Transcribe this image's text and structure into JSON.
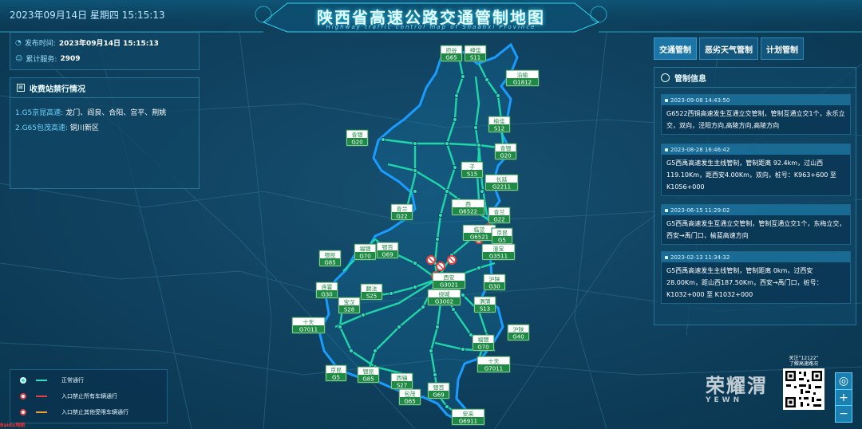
{
  "header": {
    "datetime": "2023年09月14日 星期四  15:15:13",
    "title": "陕西省高速公路交通管制地图",
    "subtitle": "Highway traffic control map of Shaanxi Province"
  },
  "info": {
    "publish_label": "发布时间:",
    "publish_value": "2023年09月14日  15:15:13",
    "service_label": "累计服务:",
    "service_value": "2909"
  },
  "toll": {
    "title": "收费站禁行情况",
    "items": [
      {
        "road": "1.G5京昆高速:",
        "text": "龙门、阎良、合阳、宫平、荆姚"
      },
      {
        "road": "2.G65包茂高速:",
        "text": "铜川新区"
      }
    ]
  },
  "tabs": [
    "交通管制",
    "恶劣天气管制",
    "计划管制"
  ],
  "control": {
    "title": "管制信息",
    "cards": [
      {
        "time": "2023-09-08 14:43:50",
        "text": "G6522西铜高速发生互通立交管制，管制互通立交1个，永乐立交，双向，泾阳方向,高陵方向,高陵方向"
      },
      {
        "time": "2023-08-28 16:46:42",
        "text": "G5西禹高速发生主线管制，管制距离 92.4km，过山西119.10Km，距西安4.00Km，双向，桩号：K963+600 至 K1056+000"
      },
      {
        "time": "2023-06-15 11:29:02",
        "text": "G5西禹高速发生互通立交管制，管制互通立交1个，东梅立交，西安→禹门口，榆蓝高速方向"
      },
      {
        "time": "2023-02-13 11:34:32",
        "text": "G5西禹高速发生主线管制，管制距离 0km，过西安28.00Km，距山西187.50Km，西安→禹门口，桩号：K1032+000 至 K1032+000"
      }
    ]
  },
  "legend": {
    "items": [
      {
        "label": "正常通行",
        "color": "#2fe0c0"
      },
      {
        "label": "入口禁止所有车辆通行",
        "color": "#e04040"
      },
      {
        "label": "入口禁止其他受限车辆通行",
        "color": "#f0a030"
      }
    ]
  },
  "qr": {
    "line1": "关注“12122”",
    "line2": "了解高速路况"
  },
  "zoom": {
    "locate": "◎",
    "plus": "+",
    "minus": "−"
  },
  "watermark": {
    "main": "荣耀渭",
    "sub": "YEWN"
  },
  "corner_logo": "Baidu地图",
  "colors": {
    "road": "#1fd6a8",
    "border": "#1a9cff",
    "accent": "#2ee3ff",
    "sign_green": "#1f8a44"
  },
  "map": {
    "signs": [
      {
        "name": "府谷",
        "code": "G65"
      },
      {
        "name": "神佳",
        "code": "S11"
      },
      {
        "name": "沿榆",
        "code": "G1812"
      },
      {
        "name": "榆佳",
        "code": "S12"
      },
      {
        "name": "青银",
        "code": "G20"
      },
      {
        "name": "青银",
        "code": "G20"
      },
      {
        "name": "子",
        "code": "S15"
      },
      {
        "name": "长延",
        "code": "G2211"
      },
      {
        "name": "西",
        "code": "G6522"
      },
      {
        "name": "青兰",
        "code": "G22"
      },
      {
        "name": "青兰",
        "code": "G22"
      },
      {
        "name": "临蓝",
        "code": "G6521"
      },
      {
        "name": "京昆",
        "code": "G5"
      },
      {
        "name": "潼宝",
        "code": "G3511"
      },
      {
        "name": "银昆",
        "code": "G85"
      },
      {
        "name": "福银",
        "code": "G70"
      },
      {
        "name": "银百",
        "code": "G69"
      },
      {
        "name": "西安",
        "code": "G3021"
      },
      {
        "name": "沪陕",
        "code": "G30"
      },
      {
        "name": "连霍",
        "code": "G30"
      },
      {
        "name": "麟法",
        "code": "S25"
      },
      {
        "name": "宝汉",
        "code": "S28"
      },
      {
        "name": "绕城",
        "code": "G3002"
      },
      {
        "name": "渭蒲",
        "code": "S13"
      },
      {
        "name": "十天",
        "code": "G7011"
      },
      {
        "name": "沪陕",
        "code": "G40"
      },
      {
        "name": "福银",
        "code": "G70"
      },
      {
        "name": "十天",
        "code": "G7011"
      },
      {
        "name": "京昆",
        "code": "G5"
      },
      {
        "name": "银昆",
        "code": "G85"
      },
      {
        "name": "西镇",
        "code": "S27"
      },
      {
        "name": "包茂",
        "code": "G65"
      },
      {
        "name": "银百",
        "code": "G69"
      },
      {
        "name": "安来",
        "code": "G6911"
      }
    ]
  }
}
